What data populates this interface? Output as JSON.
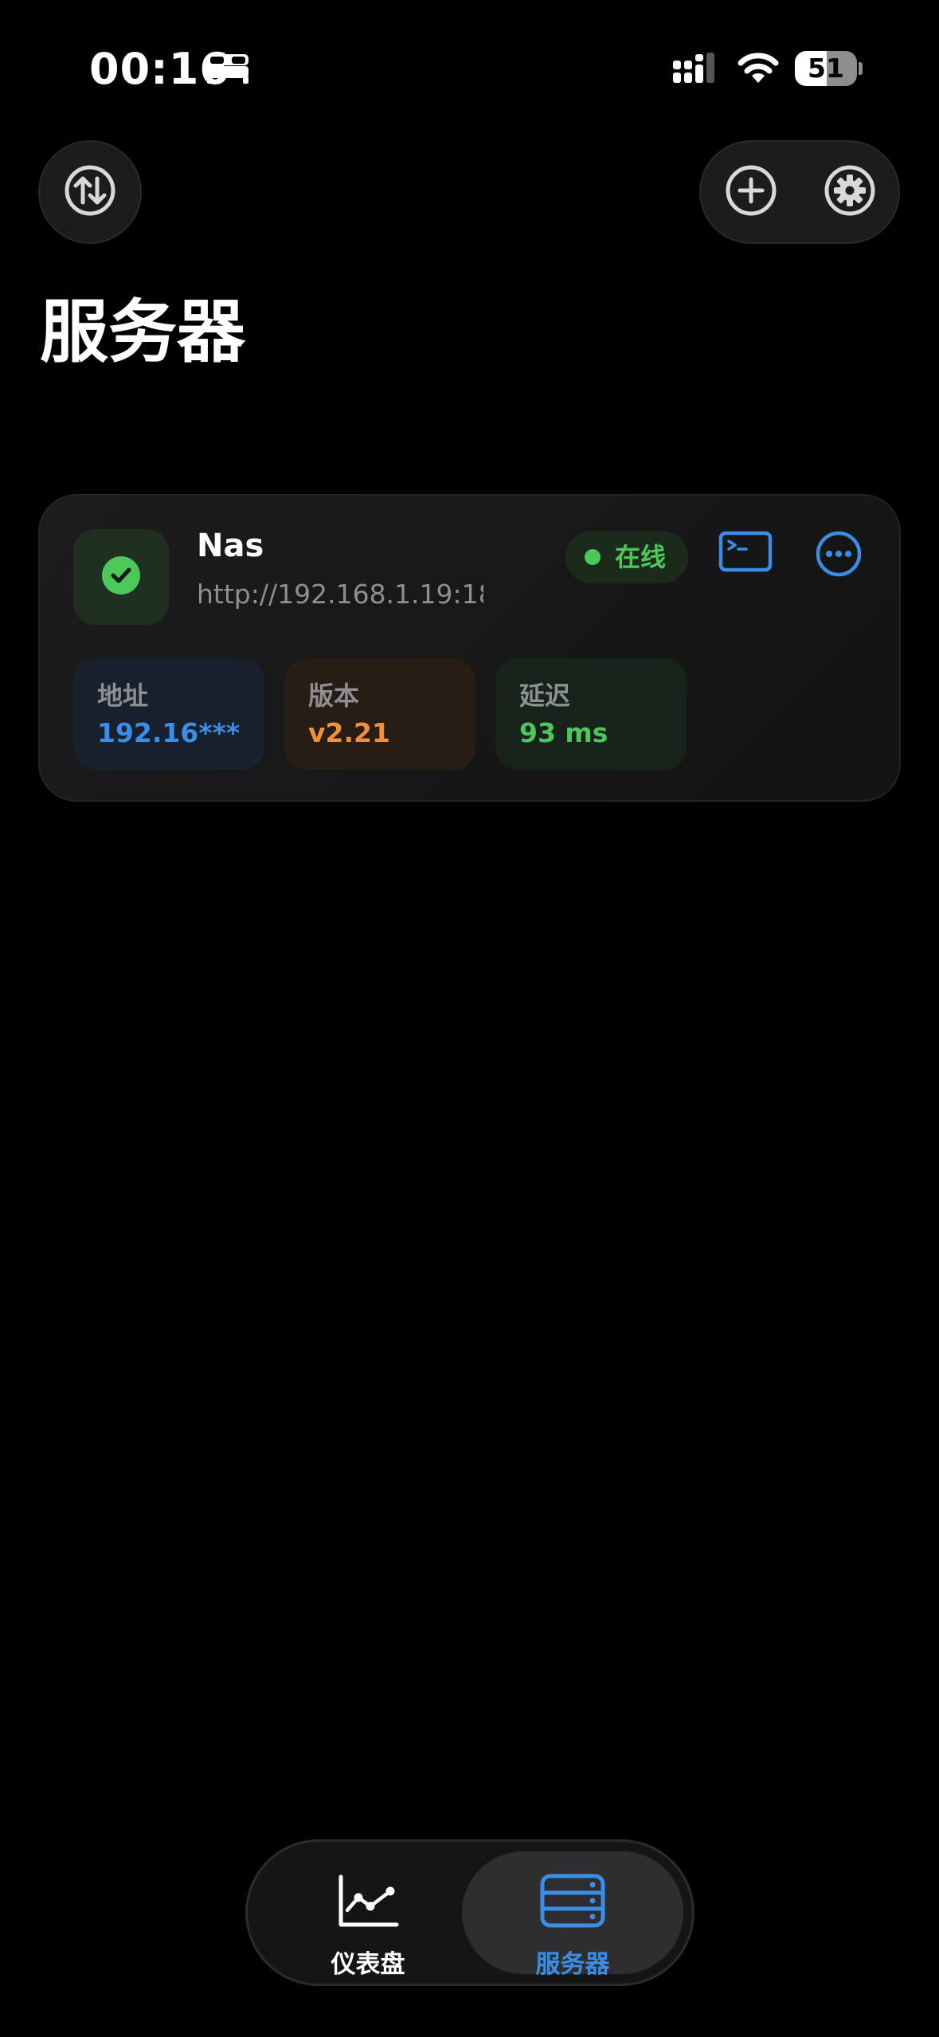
{
  "status_bar": {
    "time": "00:16",
    "battery_level": "51",
    "battery_fraction": 0.51
  },
  "header": {
    "left_button_icon": "swap-arrows-icon",
    "add_button_icon": "plus-circle-icon",
    "settings_button_icon": "gear-icon"
  },
  "page": {
    "title": "服务器"
  },
  "server": {
    "name": "Nas",
    "url": "http://192.168.1.19:18...",
    "status": "在线",
    "stats": [
      {
        "label": "地址",
        "value": "192.16***",
        "color": "#3a8ee8"
      },
      {
        "label": "版本",
        "value": "v2.21",
        "color": "#f0913a"
      },
      {
        "label": "延迟",
        "value": "93 ms",
        "color": "#4cc85a"
      }
    ]
  },
  "tab_bar": {
    "tabs": [
      {
        "label": "仪表盘",
        "icon": "line-chart-icon",
        "active": false
      },
      {
        "label": "服务器",
        "icon": "server-rack-icon",
        "active": true
      }
    ]
  },
  "colors": {
    "accent_blue": "#3a8ee8",
    "online_green": "#4cc85a",
    "version_orange": "#f0913a"
  }
}
